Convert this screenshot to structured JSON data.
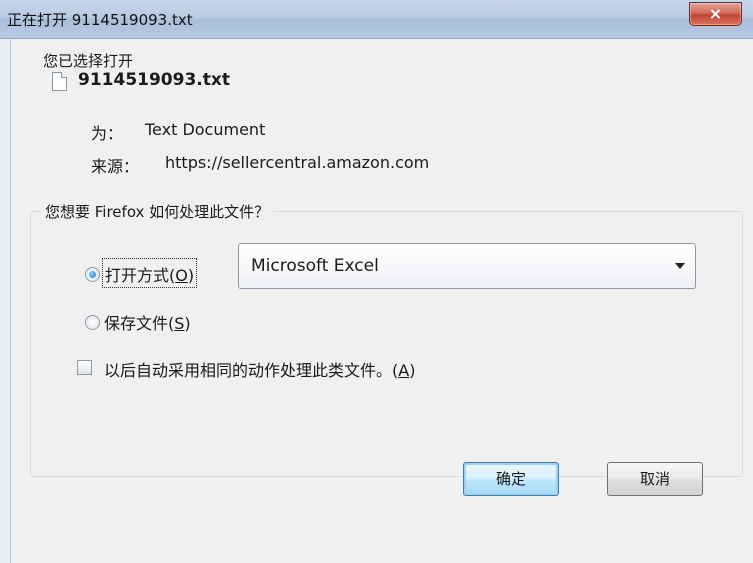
{
  "window": {
    "title": "正在打开 9114519093.txt",
    "close_icon": "×"
  },
  "header": {
    "intro": "您已选择打开",
    "file_icon": "text-document-icon",
    "filename": "9114519093.txt",
    "type_label": "为：",
    "type_value": "Text Document",
    "source_label": "来源：",
    "source_value": "https://sellercentral.amazon.com"
  },
  "action_group": {
    "label": "您想要 Firefox 如何处理此文件？",
    "open_with": {
      "label": "打开方式(",
      "accesskey": "O",
      "suffix": ")",
      "selected": true
    },
    "app_select": {
      "value": "Microsoft Excel"
    },
    "save_file": {
      "label": "保存文件(",
      "accesskey": "S",
      "suffix": ")",
      "selected": false
    },
    "remember": {
      "label": "以后自动采用相同的动作处理此类文件。(",
      "accesskey": "A",
      "suffix": ")",
      "checked": false
    }
  },
  "buttons": {
    "ok": "确定",
    "cancel": "取消"
  }
}
